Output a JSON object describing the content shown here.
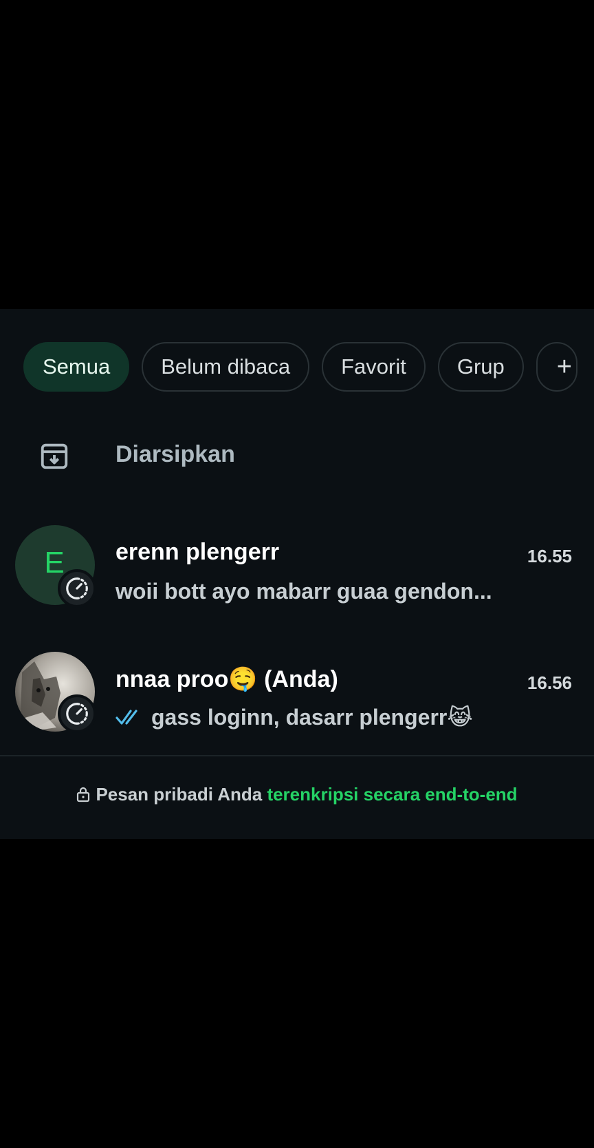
{
  "filters": {
    "all": "Semua",
    "unread": "Belum dibaca",
    "favorites": "Favorit",
    "groups": "Grup",
    "add": "+"
  },
  "archived": {
    "label": "Diarsipkan",
    "icon": "archive-icon"
  },
  "chats": [
    {
      "avatar_letter": "E",
      "name": "erenn plengerr",
      "time": "16.55",
      "preview": "woii bott ayo mabarr guaa gendon...",
      "badge_icon": "disappearing-timer-icon"
    },
    {
      "name": "nnaa proo🤤 (Anda)",
      "time": "16.56",
      "preview": "gass loginn, dasarr plengerr😹",
      "status_icon": "double-check-icon",
      "badge_icon": "disappearing-timer-icon"
    }
  ],
  "encryption": {
    "prefix": "Pesan pribadi Anda",
    "link": "terenkripsi secara end-to-end"
  },
  "colors": {
    "accent": "#25d366",
    "active_chip_bg": "#103529",
    "panel_bg": "#0b1014",
    "read_tick": "#53bdeb"
  }
}
